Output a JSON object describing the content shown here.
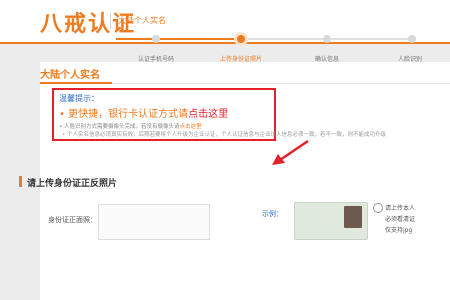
{
  "header": {
    "logo_text": "八戒认证",
    "subtitle": "大陆个人实名"
  },
  "card": {
    "title": "大陆个人实名"
  },
  "steps": [
    {
      "label": "认证手机号码",
      "state": "done"
    },
    {
      "label": "上传身份证照片",
      "state": "active"
    },
    {
      "label": "确认信息",
      "state": "todo"
    },
    {
      "label": "人脸识别",
      "state": "todo"
    }
  ],
  "notice": {
    "title": "温馨提示：",
    "main_prefix": "• 更快捷，银行卡认证方式请",
    "main_link": "点击这里",
    "sub_prefix": "• 人脸识别方式需要摄像头完成，若没有摄像头请",
    "sub_link": "点击这里",
    "tail": "• 个人实名信息必须真实有效，后期若要将个人升级为企业认证，个人认证信息与企业法人信息必须一致，若不一致，则不能成功升级"
  },
  "section": {
    "title": "请上传身份证正反照片",
    "upload_label": "身份证正面照：",
    "example_label": "示例：",
    "tips": [
      "请上传本人",
      "必须看清证",
      "仅支持jpg"
    ]
  },
  "colors": {
    "accent": "#f07a1e",
    "alert_red": "#e4202a",
    "link_blue": "#2d6ec6"
  }
}
